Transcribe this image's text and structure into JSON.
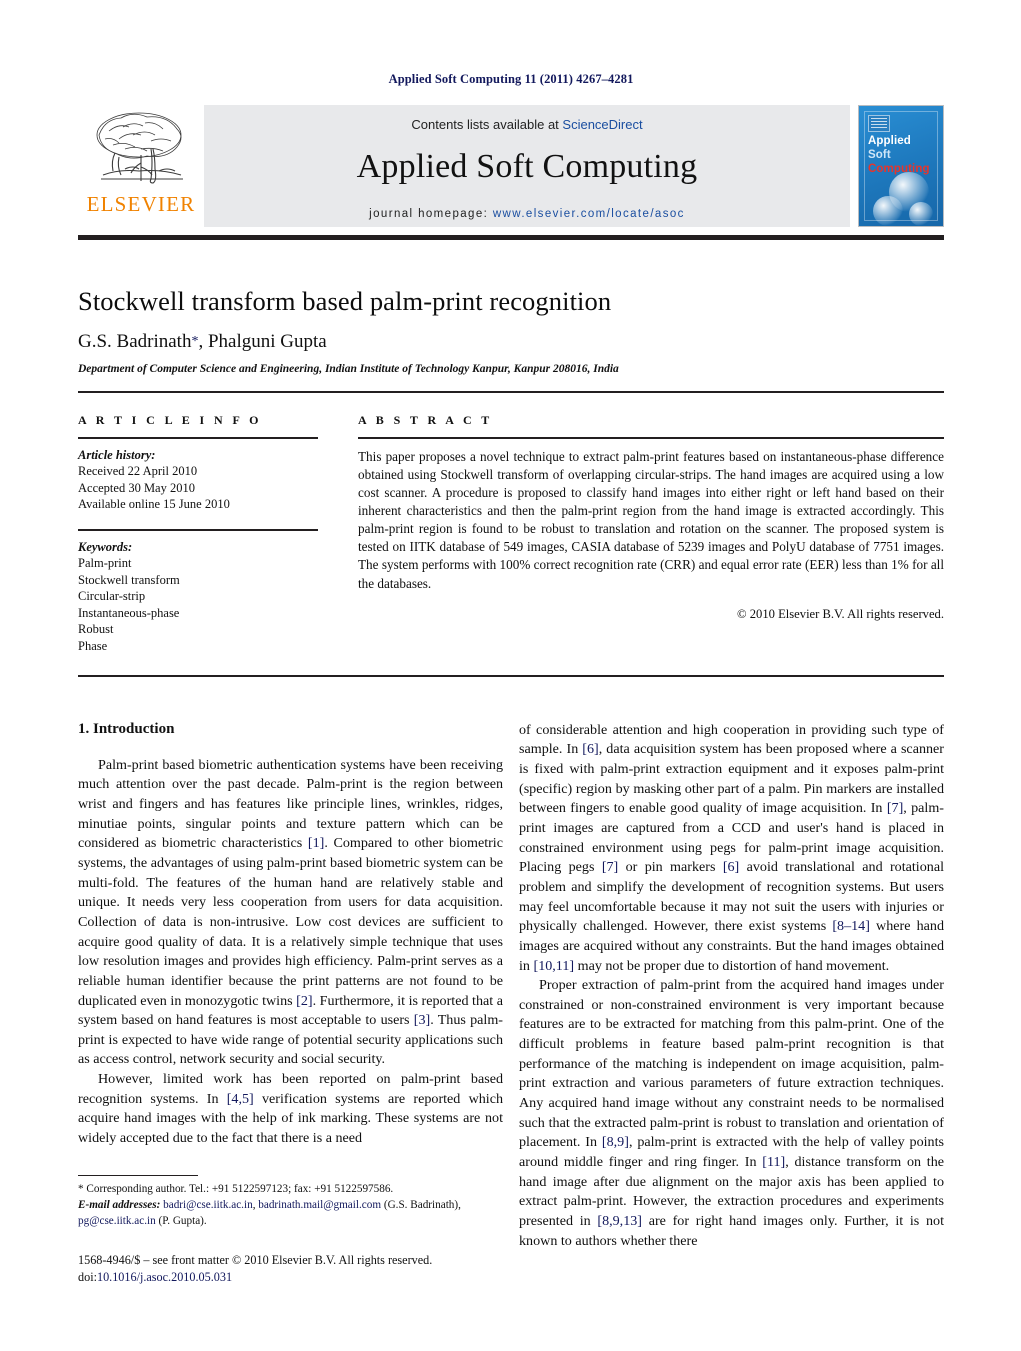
{
  "running_head": "Applied Soft Computing 11 (2011) 4267–4281",
  "masthead": {
    "publisher_name": "ELSEVIER",
    "contents_prefix": "Contents lists available at ",
    "sciencedirect": "ScienceDirect",
    "journal_title": "Applied Soft Computing",
    "homepage_prefix": "journal homepage: ",
    "homepage_url": "www.elsevier.com/locate/asoc",
    "cover": {
      "line1": "Applied",
      "line2": "Soft",
      "line3": "Computing",
      "color_background": "#1f7bc0",
      "color_line1": "#ffffff",
      "color_line2": "#cfe6f7",
      "color_line3": "#e8342b"
    }
  },
  "title_block": {
    "title": "Stockwell transform based palm-print recognition",
    "authors": "G.S. Badrinath",
    "corresponding_marker": "*",
    "authors_rest": ", Phalguni Gupta",
    "affiliation": "Department of Computer Science and Engineering, Indian Institute of Technology Kanpur, Kanpur 208016, India"
  },
  "article_info": {
    "heading": "A R T I C L E   I N F O",
    "history_label": "Article history:",
    "history": [
      "Received 22 April 2010",
      "Accepted 30 May 2010",
      "Available online 15 June 2010"
    ],
    "keywords_label": "Keywords:",
    "keywords": [
      "Palm-print",
      "Stockwell transform",
      "Circular-strip",
      "Instantaneous-phase",
      "Robust",
      "Phase"
    ]
  },
  "abstract": {
    "heading": "A B S T R A C T",
    "text": "This paper proposes a novel technique to extract palm-print features based on instantaneous-phase difference obtained using Stockwell transform of overlapping circular-strips. The hand images are acquired using a low cost scanner. A procedure is proposed to classify hand images into either right or left hand based on their inherent characteristics and then the palm-print region from the hand image is extracted accordingly. This palm-print region is found to be robust to translation and rotation on the scanner. The proposed system is tested on IITK database of 549 images, CASIA database of 5239 images and PolyU database of 7751 images. The system performs with 100% correct recognition rate (CRR) and equal error rate (EER) less than 1% for all the databases.",
    "copyright": "© 2010 Elsevier B.V. All rights reserved."
  },
  "body": {
    "section_number_title": "1.  Introduction",
    "left_column": [
      {
        "segments": [
          {
            "t": "Palm-print based biometric authentication systems have been receiving much attention over the past decade. Palm-print is the region between wrist and fingers and has features like principle lines, wrinkles, ridges, minutiae points, singular points and texture pattern which can be considered as biometric characteristics "
          },
          {
            "t": "[1]",
            "cite": true
          },
          {
            "t": ". Compared to other biometric systems, the advantages of using palm-print based biometric system can be multi-fold. The features of the human hand are relatively stable and unique. It needs very less cooperation from users for data acquisition. Collection of data is non-intrusive. Low cost devices are sufficient to acquire good quality of data. It is a relatively simple technique that uses low resolution images and provides high efficiency. Palm-print serves as a reliable human identifier because the print patterns are not found to be duplicated even in monozygotic twins "
          },
          {
            "t": "[2]",
            "cite": true
          },
          {
            "t": ". Furthermore, it is reported that a system based on hand features is most acceptable to users "
          },
          {
            "t": "[3]",
            "cite": true
          },
          {
            "t": ". Thus palm-print is expected to have wide range of potential security applications such as access control, network security and social security."
          }
        ]
      },
      {
        "segments": [
          {
            "t": "However, limited work has been reported on palm-print based recognition systems. In "
          },
          {
            "t": "[4,5]",
            "cite": true
          },
          {
            "t": " verification systems are reported which acquire hand images with the help of ink marking. These systems are not widely accepted due to the fact that there is a need"
          }
        ]
      }
    ],
    "right_column": [
      {
        "no_indent": true,
        "segments": [
          {
            "t": "of considerable attention and high cooperation in providing such type of sample. In "
          },
          {
            "t": "[6]",
            "cite": true
          },
          {
            "t": ", data acquisition system has been proposed where a scanner is fixed with palm-print extraction equipment and it exposes palm-print (specific) region by masking other part of a palm. Pin markers are installed between fingers to enable good quality of image acquisition. In "
          },
          {
            "t": "[7]",
            "cite": true
          },
          {
            "t": ", palm-print images are captured from a CCD and user's hand is placed in constrained environment using pegs for palm-print image acquisition. Placing pegs "
          },
          {
            "t": "[7]",
            "cite": true
          },
          {
            "t": " or pin markers "
          },
          {
            "t": "[6]",
            "cite": true
          },
          {
            "t": " avoid translational and rotational problem and simplify the development of recognition systems. But users may feel uncomfortable because it may not suit the users with injuries or physically challenged. However, there exist systems "
          },
          {
            "t": "[8–14]",
            "cite": true
          },
          {
            "t": " where hand images are acquired without any constraints. But the hand images obtained in "
          },
          {
            "t": "[10,11]",
            "cite": true
          },
          {
            "t": " may not be proper due to distortion of hand movement."
          }
        ]
      },
      {
        "segments": [
          {
            "t": "Proper extraction of palm-print from the acquired hand images under constrained or non-constrained environment is very important because features are to be extracted for matching from this palm-print. One of the difficult problems in feature based palm-print recognition is that performance of the matching is independent on image acquisition, palm-print extraction and various parameters of future extraction techniques. Any acquired hand image without any constraint needs to be normalised such that the extracted palm-print is robust to translation and orientation of placement. In "
          },
          {
            "t": "[8,9]",
            "cite": true
          },
          {
            "t": ", palm-print is extracted with the help of valley points around middle finger and ring finger. In "
          },
          {
            "t": "[11]",
            "cite": true
          },
          {
            "t": ", distance transform on the hand image after due alignment on the major axis has been applied to extract palm-print. However, the extraction procedures and experiments presented in "
          },
          {
            "t": "[8,9,13]",
            "cite": true
          },
          {
            "t": " are for right hand images only. Further, it is not known to authors whether there"
          }
        ]
      }
    ]
  },
  "footnote": {
    "corresponding_marker": "*",
    "corresponding_text": " Corresponding author. Tel.: +91 5122597123; fax: +91 5122597586.",
    "email_label": "E-mail addresses:",
    "email1": "badri@cse.iitk.ac.in",
    "email_sep1": ", ",
    "email2": "badrinath.mail@gmail.com",
    "email_owner1": "(G.S. Badrinath), ",
    "email3": "pg@cse.iitk.ac.in",
    "email_owner2": " (P. Gupta).",
    "issn_line": "1568-4946/$ – see front matter © 2010 Elsevier B.V. All rights reserved.",
    "doi_prefix": "doi:",
    "doi_value": "10.1016/j.asoc.2010.05.031"
  }
}
